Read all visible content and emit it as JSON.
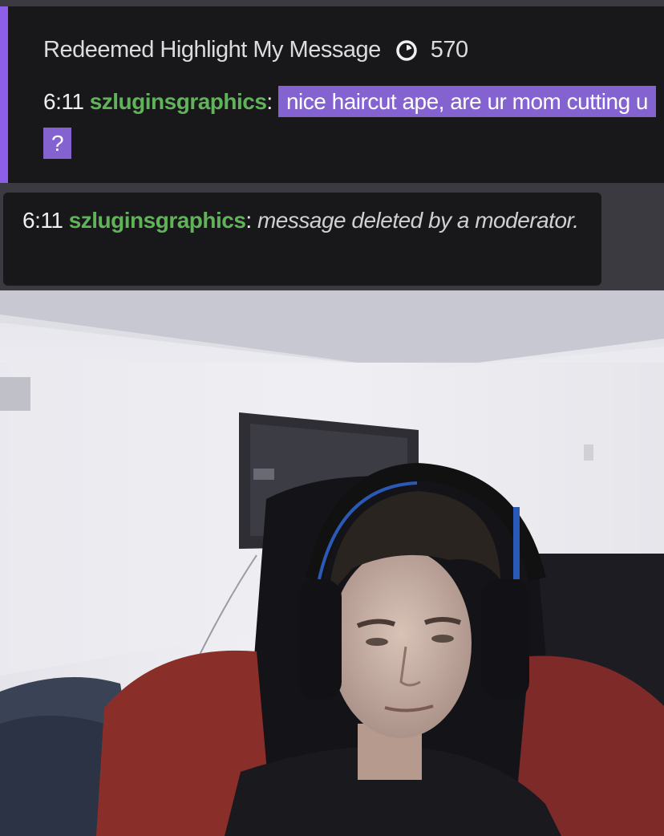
{
  "highlight": {
    "redeem_text": "Redeemed Highlight My Message",
    "points_icon": "channel-points-icon",
    "points": "570",
    "timestamp": "6:11",
    "username": "szluginsgraphics",
    "separator": ":",
    "message": "nice haircut ape, are ur mom cutting u ?"
  },
  "deleted": {
    "timestamp": "6:11",
    "username": "szluginsgraphics",
    "separator": ":",
    "message": "message deleted by a moderator."
  },
  "colors": {
    "highlight_bar": "#8d5ee8",
    "highlight_bg": "#8462d0",
    "username": "#61b35a",
    "chat_bg": "#18181b"
  }
}
